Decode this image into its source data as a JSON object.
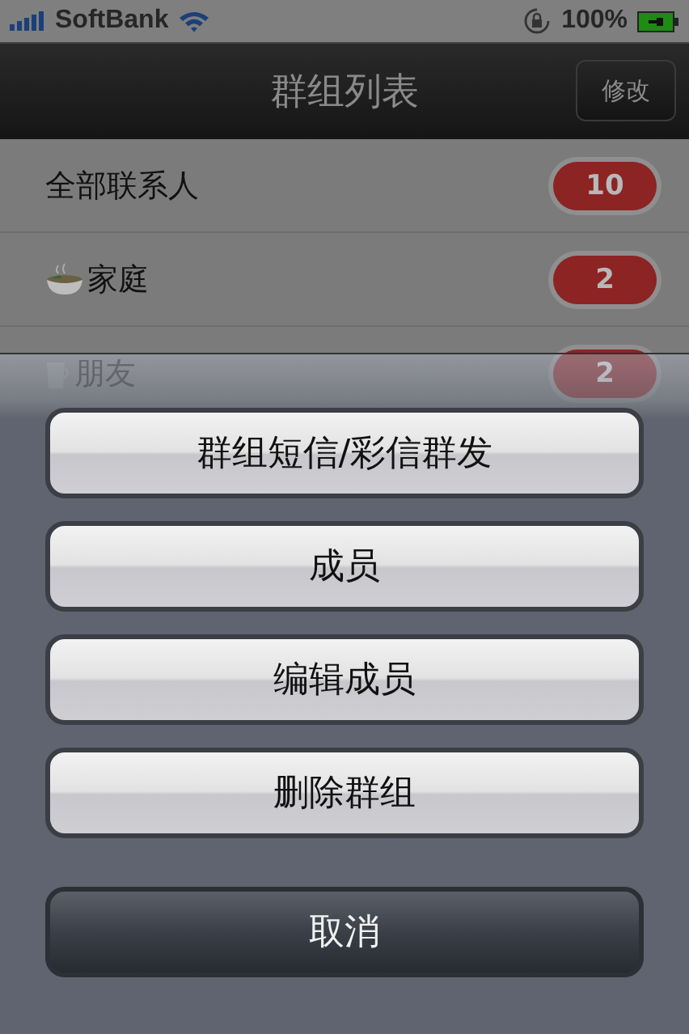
{
  "status_bar": {
    "carrier": "SoftBank",
    "battery": "100%"
  },
  "nav": {
    "title": "群组列表",
    "edit_button": "修改"
  },
  "groups": [
    {
      "kind": "plain",
      "name": "全部联系人",
      "count": "10"
    },
    {
      "kind": "bowl",
      "name": "家庭",
      "count": "2"
    },
    {
      "kind": "cup",
      "name": "朋友",
      "count": "2"
    }
  ],
  "action_sheet": {
    "buttons": [
      {
        "kind": "default",
        "label": "群组短信/彩信群发"
      },
      {
        "kind": "default",
        "label": "成员"
      },
      {
        "kind": "default",
        "label": "编辑成员"
      },
      {
        "kind": "default",
        "label": "删除群组"
      },
      {
        "kind": "cancel",
        "label": "取消"
      }
    ]
  }
}
